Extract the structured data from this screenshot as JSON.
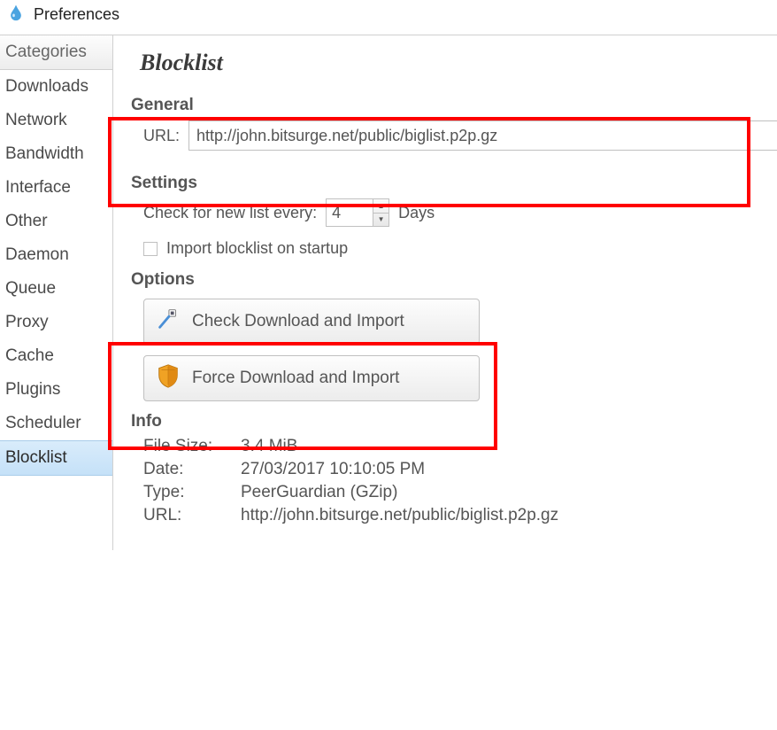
{
  "window": {
    "title": "Preferences"
  },
  "sidebar": {
    "header": "Categories",
    "items": [
      {
        "label": "Downloads"
      },
      {
        "label": "Network"
      },
      {
        "label": "Bandwidth"
      },
      {
        "label": "Interface"
      },
      {
        "label": "Other"
      },
      {
        "label": "Daemon"
      },
      {
        "label": "Queue"
      },
      {
        "label": "Proxy"
      },
      {
        "label": "Cache"
      },
      {
        "label": "Plugins"
      },
      {
        "label": "Scheduler"
      },
      {
        "label": "Blocklist",
        "selected": true
      }
    ]
  },
  "page": {
    "title": "Blocklist",
    "general": {
      "heading": "General",
      "url_label": "URL:",
      "url_value": "http://john.bitsurge.net/public/biglist.p2p.gz"
    },
    "settings": {
      "heading": "Settings",
      "check_label": "Check for new list every:",
      "check_value": "4",
      "check_unit": "Days",
      "import_startup_label": "Import blocklist on startup",
      "import_startup_checked": false
    },
    "options": {
      "heading": "Options",
      "check_btn": "Check Download and Import",
      "force_btn": "Force Download and Import"
    },
    "info": {
      "heading": "Info",
      "file_size_label": "File Size:",
      "file_size_value": "3.4 MiB",
      "date_label": "Date:",
      "date_value": "27/03/2017 10:10:05 PM",
      "type_label": "Type:",
      "type_value": "PeerGuardian (GZip)",
      "url_label": "URL:",
      "url_value": "http://john.bitsurge.net/public/biglist.p2p.gz"
    }
  }
}
